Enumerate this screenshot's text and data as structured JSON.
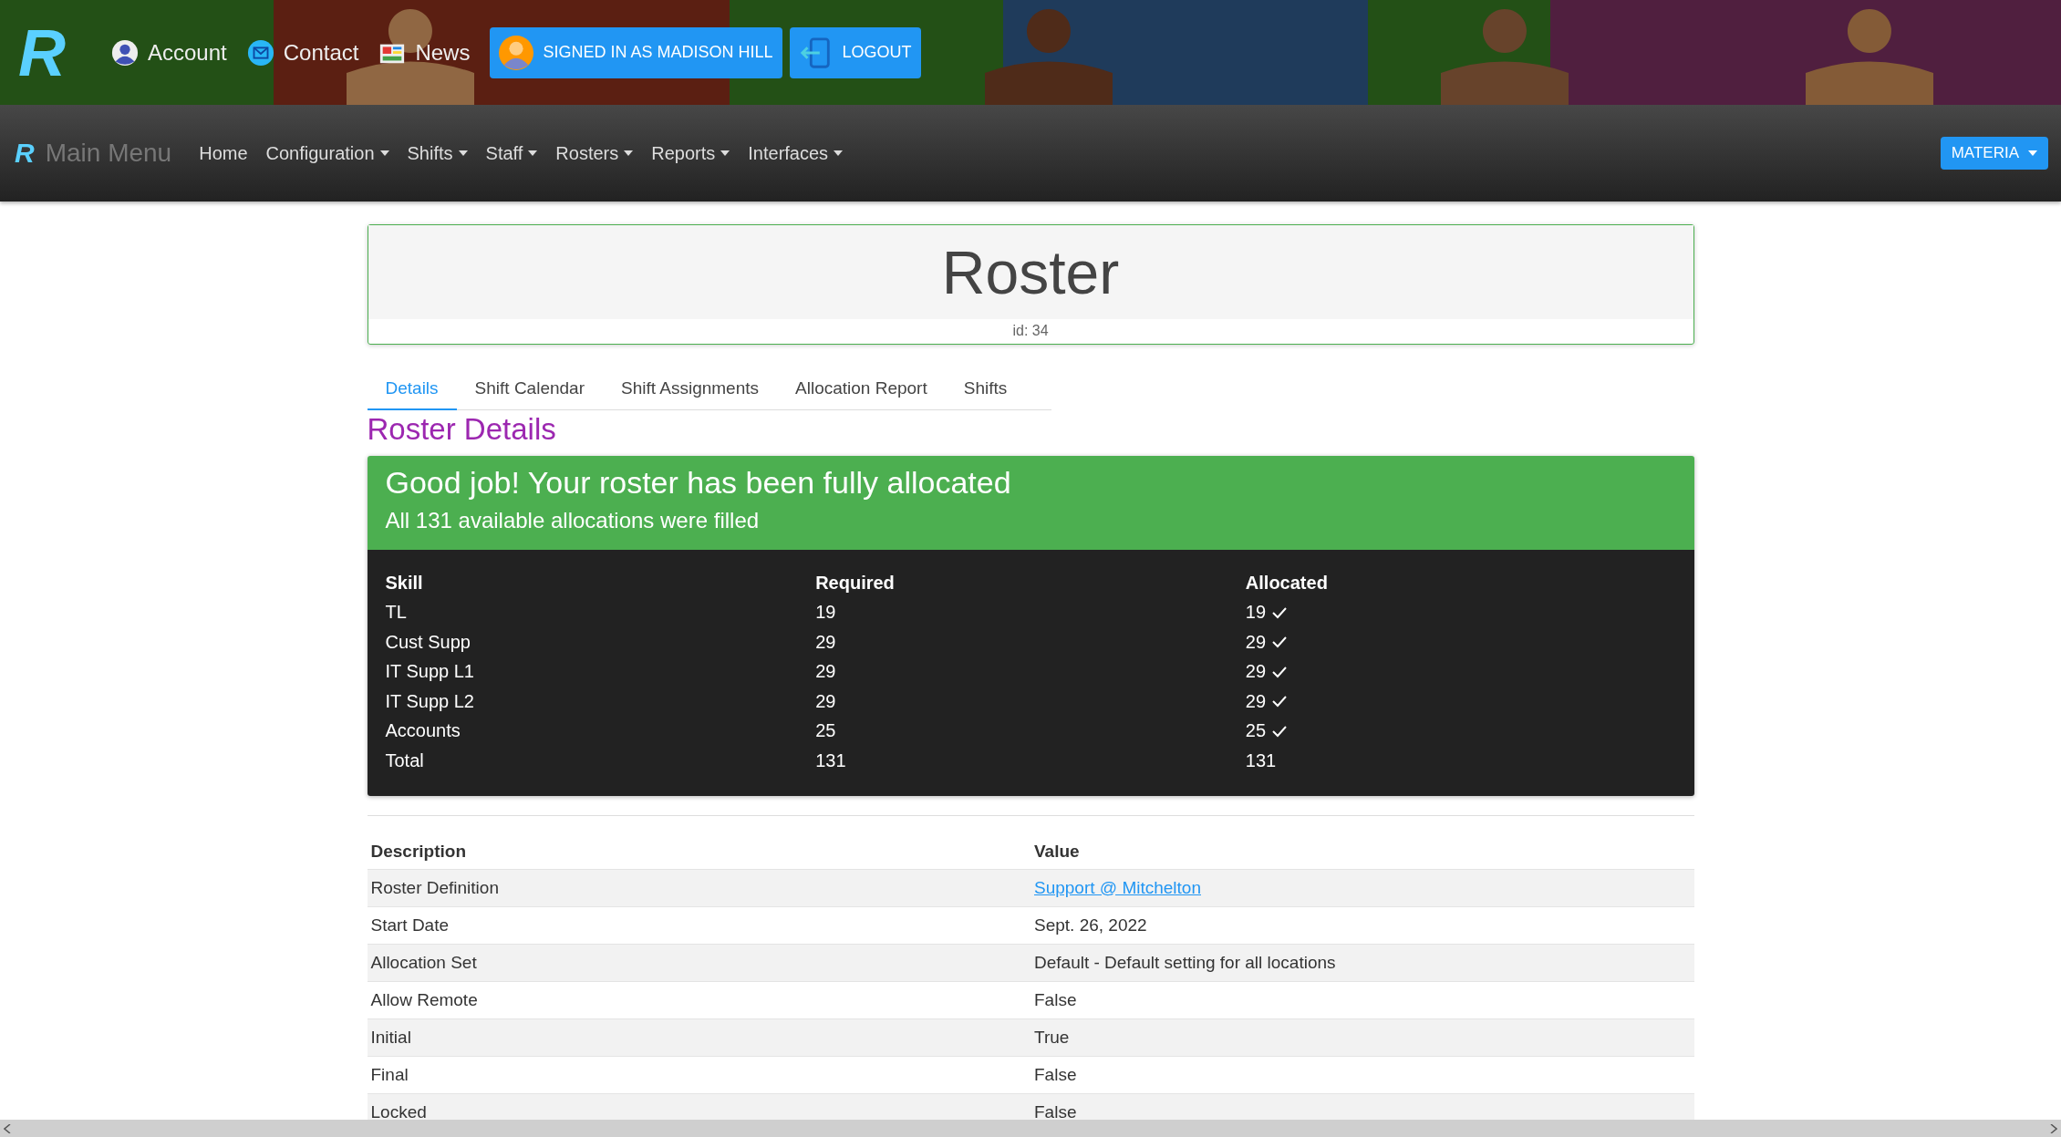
{
  "banner": {
    "logo": "R",
    "links": [
      {
        "label": "Account"
      },
      {
        "label": "Contact"
      },
      {
        "label": "News"
      }
    ],
    "buttons": [
      {
        "label": "SIGNED IN AS MADISON HILL"
      },
      {
        "label": "LOGOUT"
      }
    ]
  },
  "navbar": {
    "logo": "R",
    "brand": "Main Menu",
    "items": [
      {
        "label": "Home",
        "dropdown": false
      },
      {
        "label": "Configuration",
        "dropdown": true
      },
      {
        "label": "Shifts",
        "dropdown": true
      },
      {
        "label": "Staff",
        "dropdown": true
      },
      {
        "label": "Rosters",
        "dropdown": true
      },
      {
        "label": "Reports",
        "dropdown": true
      },
      {
        "label": "Interfaces",
        "dropdown": true
      }
    ],
    "theme_button": "MATERIA"
  },
  "header_card": {
    "title": "Roster",
    "id_label": "id: 34"
  },
  "tabs": [
    {
      "label": "Details",
      "selected": true
    },
    {
      "label": "Shift Calendar",
      "selected": false
    },
    {
      "label": "Shift Assignments",
      "selected": false
    },
    {
      "label": "Allocation Report",
      "selected": false
    },
    {
      "label": "Shifts",
      "selected": false
    }
  ],
  "section_title": "Roster Details",
  "alert": {
    "heading": "Good job! Your roster has been fully allocated",
    "message": "All 131 available allocations were filled",
    "columns": [
      "Skill",
      "Required",
      "Allocated"
    ],
    "rows": [
      {
        "skill": "TL",
        "required": "19",
        "allocated": "19",
        "met": true
      },
      {
        "skill": "Cust Supp",
        "required": "29",
        "allocated": "29",
        "met": true
      },
      {
        "skill": "IT Supp L1",
        "required": "29",
        "allocated": "29",
        "met": true
      },
      {
        "skill": "IT Supp L2",
        "required": "29",
        "allocated": "29",
        "met": true
      },
      {
        "skill": "Accounts",
        "required": "25",
        "allocated": "25",
        "met": true
      },
      {
        "skill": "Total",
        "required": "131",
        "allocated": "131",
        "met": false
      }
    ]
  },
  "details": {
    "columns": [
      "Description",
      "Value"
    ],
    "rows": [
      {
        "description": "Roster Definition",
        "value": "Support @ Mitchelton",
        "kind": "link"
      },
      {
        "description": "Start Date",
        "value": "Sept. 26, 2022",
        "kind": "text"
      },
      {
        "description": "Allocation Set",
        "value": "Default - Default setting for all locations",
        "kind": "text"
      },
      {
        "description": "Allow Remote",
        "value": "False",
        "kind": "text"
      },
      {
        "description": "Initial",
        "value": "True",
        "kind": "text"
      },
      {
        "description": "Final",
        "value": "False",
        "kind": "text"
      },
      {
        "description": "Locked",
        "value": "False",
        "kind": "text"
      }
    ]
  }
}
